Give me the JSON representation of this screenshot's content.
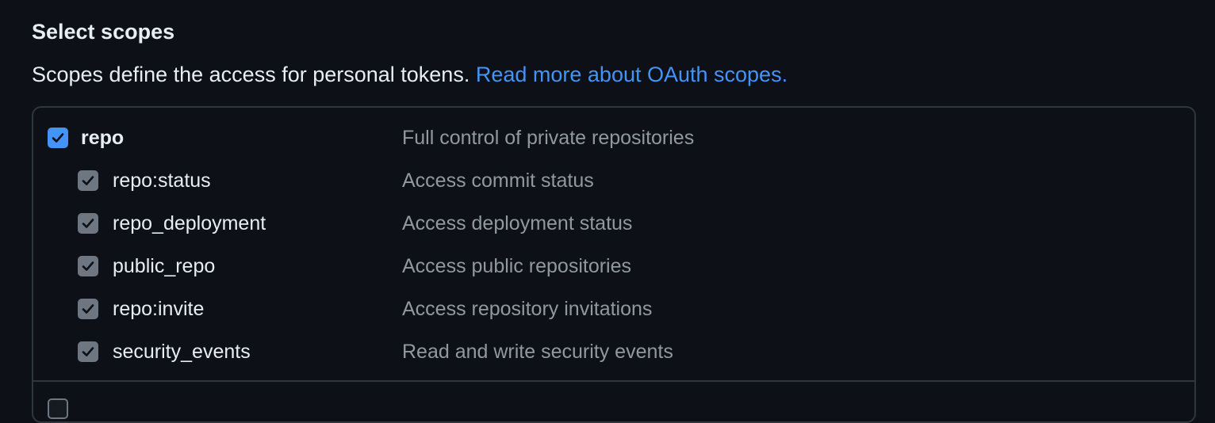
{
  "header": {
    "title": "Select scopes",
    "description": "Scopes define the access for personal tokens.",
    "link_text": "Read more about OAuth scopes."
  },
  "scopes": {
    "parent": {
      "name": "repo",
      "description": "Full control of private repositories",
      "checked": true
    },
    "children": [
      {
        "name": "repo:status",
        "description": "Access commit status",
        "checked": true
      },
      {
        "name": "repo_deployment",
        "description": "Access deployment status",
        "checked": true
      },
      {
        "name": "public_repo",
        "description": "Access public repositories",
        "checked": true
      },
      {
        "name": "repo:invite",
        "description": "Access repository invitations",
        "checked": true
      },
      {
        "name": "security_events",
        "description": "Read and write security events",
        "checked": true
      }
    ],
    "next_group": {
      "checked": false
    }
  },
  "colors": {
    "background": "#0d1117",
    "accent": "#4493f8",
    "muted_text": "#9198a1",
    "border": "#30363d"
  },
  "icons": {
    "check": "check-icon"
  }
}
